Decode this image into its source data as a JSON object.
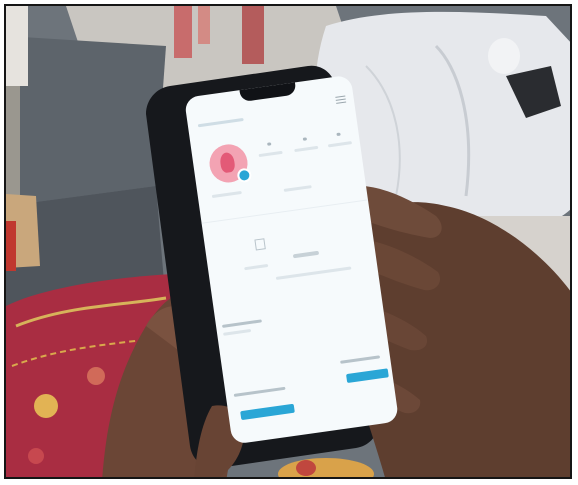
{
  "scene": {
    "description_free": true,
    "colors": {
      "floor": "#6e757c",
      "rug": "#b02f45",
      "bag": "#e4e6ea",
      "skin": "#6a4736",
      "phone_body": "#16181c",
      "screen": "#f6fafc",
      "accent": "#2aa6d6",
      "avatar": "#f3a3b3"
    }
  },
  "phone": {
    "icons": {
      "menu": "menu-icon",
      "profile": "profile-icon",
      "avatar_badge": "add-icon"
    }
  }
}
